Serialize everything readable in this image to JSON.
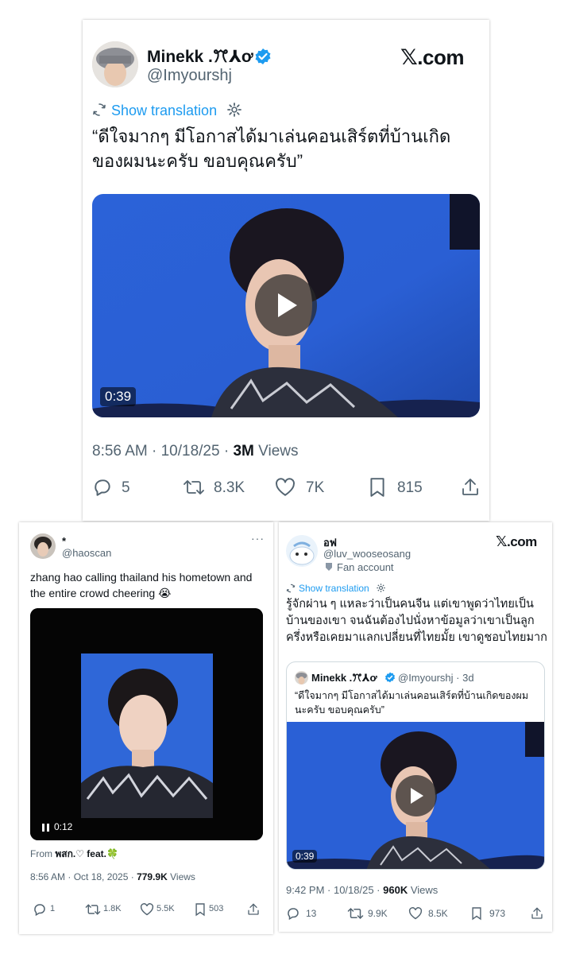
{
  "main_post": {
    "author_name": "Minekk .ꔫ⅄ơ",
    "author_handle": "@Imyourshj",
    "site_logo": ".com",
    "show_translation": "Show translation",
    "text": "“ดีใจมากๆ มีโอกาสได้มาเล่นคอนเสิร์ตที่บ้านเกิดของผมนะครับ ขอบคุณครับ”",
    "video_duration": "0:39",
    "timestamp": "8:56 AM · 10/18/25 · ",
    "views_count": "3M",
    "views_label": " Views",
    "replies": "5",
    "reposts": "8.3K",
    "likes": "7K",
    "bookmarks": "815"
  },
  "left_post": {
    "author_name": "*",
    "author_handle": "@haoscan",
    "text": "zhang hao calling thailand his hometown and the entire crowd cheering 😭",
    "video_time": "0:12",
    "from_label": "From ",
    "from_source": "พสก.♡ feat.🍀",
    "timestamp": "8:56 AM · Oct 18, 2025 · ",
    "views_count": "779.9K",
    "views_label": " Views",
    "replies": "1",
    "reposts": "1.8K",
    "likes": "5.5K",
    "bookmarks": "503"
  },
  "right_post": {
    "author_name": "อฟ",
    "author_handle": "@luv_wooseosang",
    "account_label": "Fan account",
    "site_logo": ".com",
    "show_translation": "Show translation",
    "text": "รู้จักผ่าน ๆ แหละว่าเป็นคนจีน แต่เขาพูดว่าไทยเป็นบ้านของเขา จนฉันต้องไปนั่งหาข้อมูลว่าเขาเป็นลูกครึ่งหรือเคยมาแลกเปลี่ยนที่ไทยมั้ย เขาดูชอบไทยมาก",
    "quote_author": "Minekk .ꔫ⅄ơ",
    "quote_meta": "@Imyourshj · 3d",
    "quote_text": "“ดีใจมากๆ มีโอกาสได้มาเล่นคอนเสิร์ตที่บ้านเกิดของผมนะครับ ขอบคุณครับ”",
    "video_duration": "0:39",
    "timestamp": "9:42 PM · 10/18/25 · ",
    "views_count": "960K",
    "views_label": " Views",
    "replies": "13",
    "reposts": "9.9K",
    "likes": "8.5K",
    "bookmarks": "973"
  },
  "colors": {
    "accent": "#1d9bf0",
    "muted": "#536471",
    "video_blue": "#2d66de"
  },
  "icons": [
    "verified-badge-icon",
    "translate-icon",
    "gear-icon",
    "play-icon",
    "pause-icon",
    "reply-icon",
    "repost-icon",
    "like-icon",
    "bookmark-icon",
    "share-icon",
    "more-icon",
    "fan-badge-icon",
    "x-logo-icon"
  ]
}
